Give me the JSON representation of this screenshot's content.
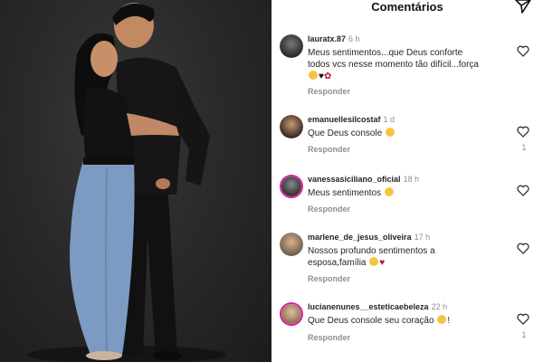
{
  "header": {
    "title": "Comentários",
    "send_icon": "send-icon"
  },
  "photo": {
    "description_icon": "photo-image"
  },
  "comments": [
    {
      "username": "lauratx.87",
      "time": "6 h",
      "text1": "Meus sentimentos...que Deus conforte",
      "text2": "todos vcs nesse momento tão difícil...força",
      "reply": "Responder",
      "likes": ""
    },
    {
      "username": "emanuellesilcostaf",
      "time": "1 d",
      "text1": "Que Deus console",
      "reply": "Responder",
      "likes": "1"
    },
    {
      "username": "vanessasiciliano_oficial",
      "time": "18 h",
      "text1": "Meus sentimentos",
      "reply": "Responder",
      "likes": ""
    },
    {
      "username": "marlene_de_jesus_oliveira",
      "time": "17 h",
      "text1": "Nossos profundo sentimentos a",
      "text2": "esposa,família",
      "reply": "Responder",
      "likes": ""
    },
    {
      "username": "lucianenunes__esteticaebeleza",
      "time": "22 h",
      "text1": "Que Deus console seu coração",
      "text1_suffix": "!",
      "reply": "Responder",
      "likes": "1"
    }
  ],
  "colors": {
    "story_ring": "#d6249f",
    "muted": "#8e8e8e",
    "text": "#262626"
  }
}
